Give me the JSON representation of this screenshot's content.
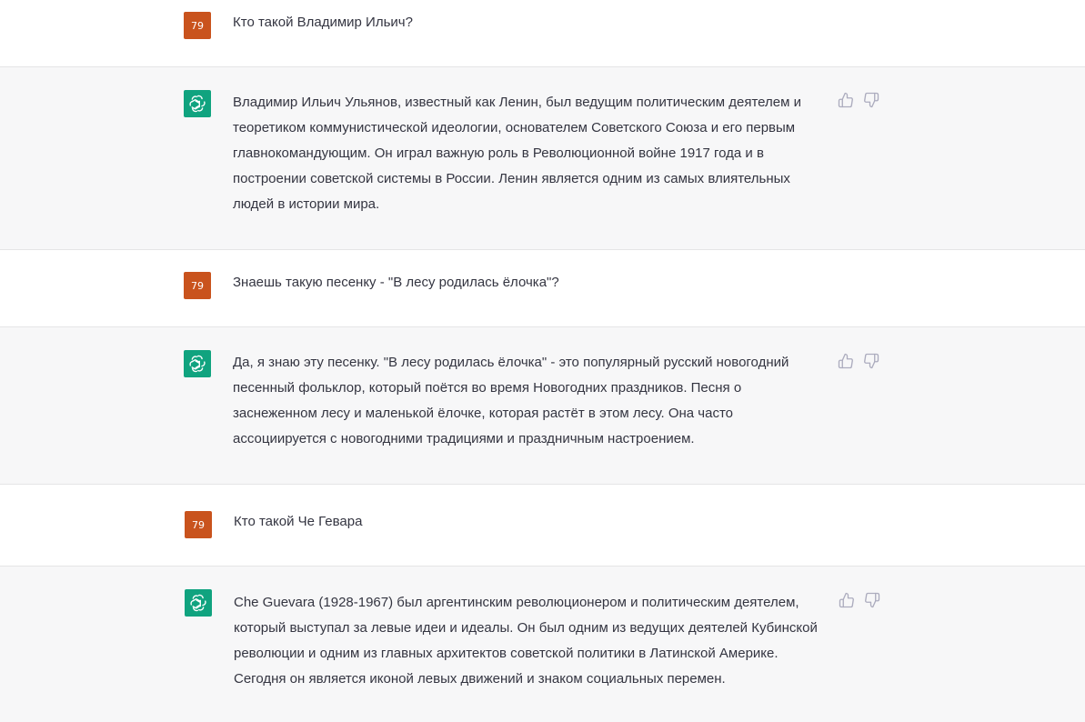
{
  "user_avatar_label": "79",
  "messages": [
    {
      "role": "user",
      "text": "Кто такой Владимир Ильич?"
    },
    {
      "role": "assistant",
      "text": "Владимир Ильич Ульянов, известный как Ленин, был ведущим политическим деятелем и теоретиком коммунистической идеологии, основателем Советского Союза и его первым главнокомандующим. Он играл важную роль в Революционной войне 1917 года и в построении советской системы в России. Ленин является одним из самых влиятельных людей в истории мира."
    },
    {
      "role": "user",
      "text": "Знаешь такую песенку - \"В лесу родилась ёлочка\"?"
    },
    {
      "role": "assistant",
      "text": "Да, я знаю эту песенку. \"В лесу родилась ёлочка\" - это популярный русский новогодний песенный фольклор, который поётся во время Новогодних праздников. Песня о заснеженном лесу и маленькой ёлочке, которая растёт в этом лесу. Она часто ассоциируется с новогодними традициями и праздничным настроением."
    },
    {
      "role": "user",
      "text": "Кто такой Че Гевара"
    },
    {
      "role": "assistant",
      "text": "Che Guevara (1928-1967) был аргентинским революционером и политическим деятелем, который выступал за левые идеи и идеалы. Он был одним из ведущих деятелей Кубинской революции и одним из главных архитектов советской политики в Латинской Америке. Сегодня он является иконой левых движений и знаком социальных перемен."
    }
  ],
  "icons": {
    "user_avatar": "user-avatar-badge",
    "assistant_avatar": "openai-logo-icon",
    "like": "thumbs-up-icon",
    "dislike": "thumbs-down-icon"
  },
  "colors": {
    "user_avatar_bg": "#c9531d",
    "assistant_avatar_bg": "#10a37f",
    "assistant_row_bg": "#f7f7f8"
  }
}
